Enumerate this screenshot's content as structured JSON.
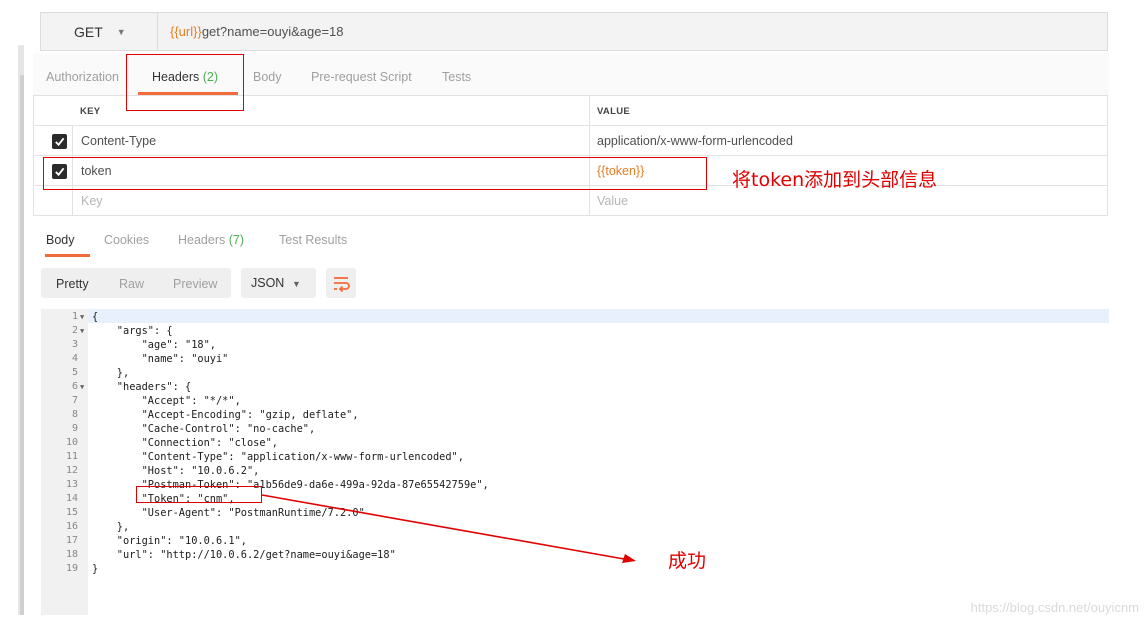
{
  "request": {
    "method": "GET",
    "url_var": "{{url}}",
    "url_rest": "get?name=ouyi&age=18"
  },
  "request_tabs": [
    {
      "label": "Authorization",
      "count": ""
    },
    {
      "label": "Headers",
      "count": "(2)"
    },
    {
      "label": "Body",
      "count": ""
    },
    {
      "label": "Pre-request Script",
      "count": ""
    },
    {
      "label": "Tests",
      "count": ""
    }
  ],
  "headers_table": {
    "key_header": "KEY",
    "value_header": "VALUE",
    "rows": [
      {
        "checked": true,
        "key": "Content-Type",
        "value": "application/x-www-form-urlencoded"
      },
      {
        "checked": true,
        "key": "token",
        "value": "{{token}}"
      }
    ],
    "key_placeholder": "Key",
    "value_placeholder": "Value"
  },
  "response_tabs": [
    {
      "label": "Body",
      "count": ""
    },
    {
      "label": "Cookies",
      "count": ""
    },
    {
      "label": "Headers",
      "count": "(7)"
    },
    {
      "label": "Test Results",
      "count": ""
    }
  ],
  "view_modes": [
    "Pretty",
    "Raw",
    "Preview"
  ],
  "format": "JSON",
  "code_lines": [
    "{",
    "    \"args\": {",
    "        \"age\": \"18\",",
    "        \"name\": \"ouyi\"",
    "    },",
    "    \"headers\": {",
    "        \"Accept\": \"*/*\",",
    "        \"Accept-Encoding\": \"gzip, deflate\",",
    "        \"Cache-Control\": \"no-cache\",",
    "        \"Connection\": \"close\",",
    "        \"Content-Type\": \"application/x-www-form-urlencoded\",",
    "        \"Host\": \"10.0.6.2\",",
    "        \"Postman-Token\": \"a1b56de9-da6e-499a-92da-87e65542759e\",",
    "        \"Token\": \"cnm\",",
    "        \"User-Agent\": \"PostmanRuntime/7.2.0\"",
    "    },",
    "    \"origin\": \"10.0.6.1\",",
    "    \"url\": \"http://10.0.6.2/get?name=ouyi&age=18\"",
    "}"
  ],
  "annotations": {
    "token_note": "将token添加到头部信息",
    "success_note": "成功"
  },
  "watermark": "https://blog.csdn.net/ouyicnm",
  "colors": {
    "accent": "#f26b3a",
    "variable": "#e67e22",
    "count": "#4caf50",
    "annotation_red": "#e00000"
  }
}
